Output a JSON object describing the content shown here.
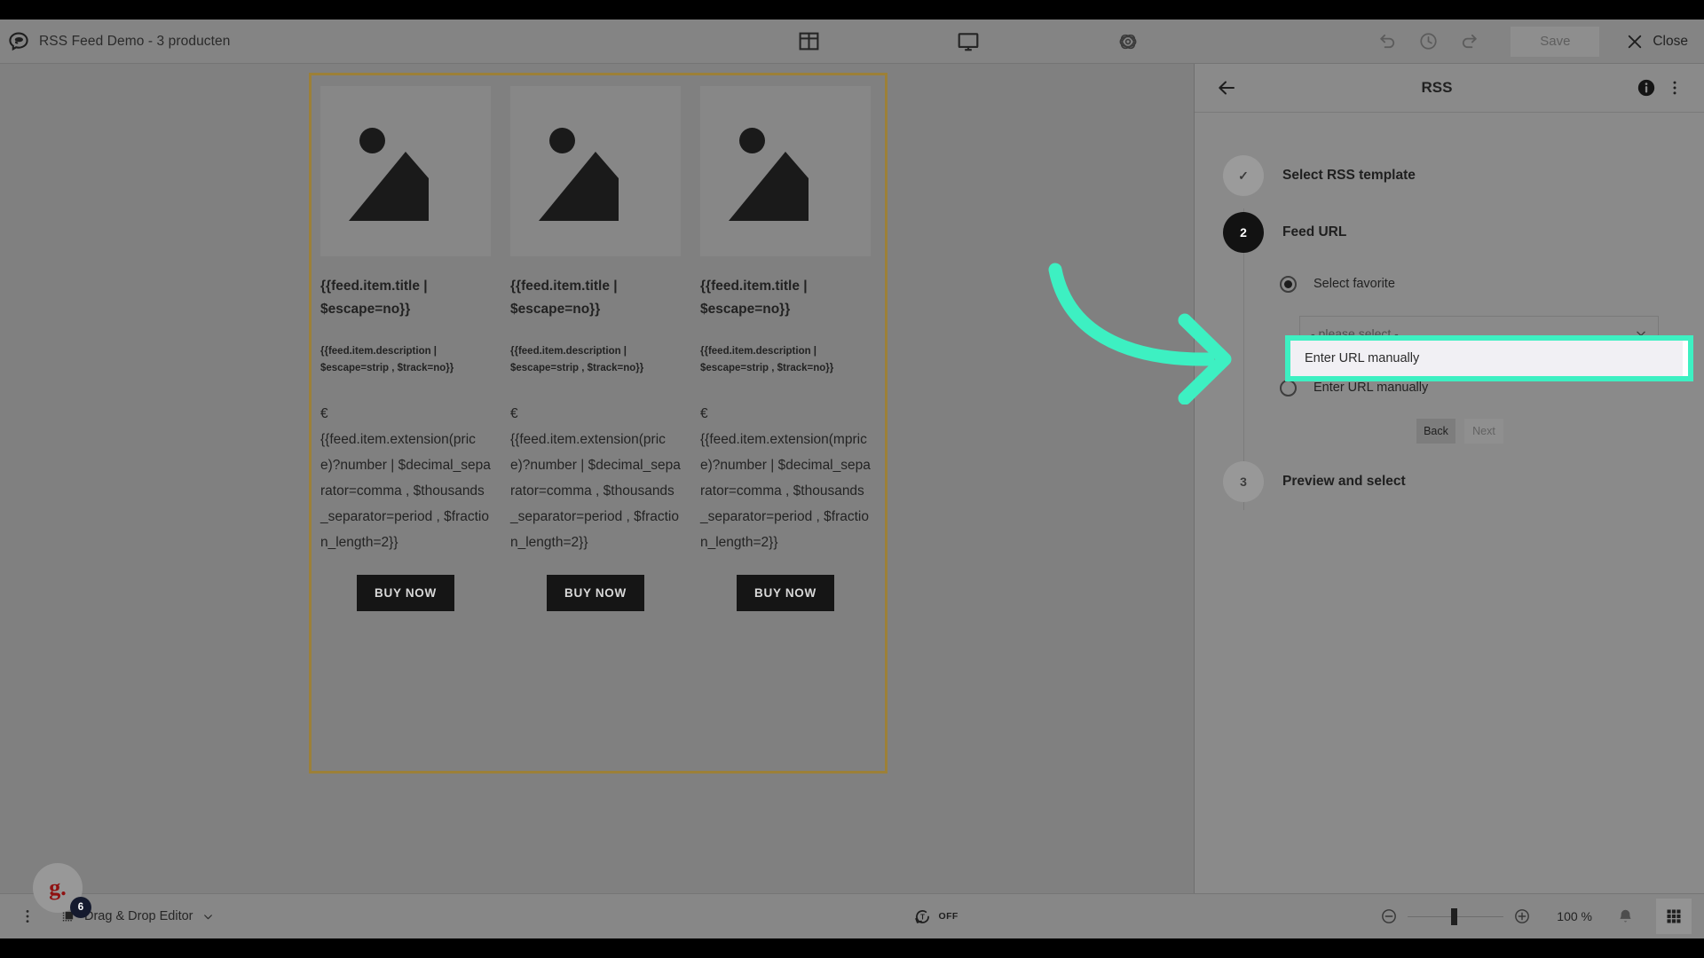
{
  "topbar": {
    "app_icon": "mail-logo-icon",
    "title": "RSS Feed Demo - 3 producten",
    "center_icons": [
      {
        "name": "layout-grid-icon",
        "label": "Layout"
      },
      {
        "name": "desktop-preview-icon",
        "label": "Preview"
      },
      {
        "name": "settings-atom-icon",
        "label": "Settings"
      }
    ],
    "undo_label": "Undo",
    "history_label": "History",
    "redo_label": "Redo",
    "save_label": "Save",
    "close_label": "Close"
  },
  "canvas": {
    "frame_border_color": "#9c8038",
    "cards": [
      {
        "image_placeholder": "image-placeholder-icon",
        "title": "{{feed.item.title | $escape=no}}",
        "description": "{{feed.item.description | $escape=strip , $track=no}}",
        "currency": "€",
        "price_expression": "{{feed.item.extension(price)?number | $decimal_separator=comma , $thousands_separator=period , $fraction_length=2}}",
        "button_label": "BUY NOW"
      },
      {
        "image_placeholder": "image-placeholder-icon",
        "title": "{{feed.item.title | $escape=no}}",
        "description": "{{feed.item.description | $escape=strip , $track=no}}",
        "currency": "€",
        "price_expression": "{{feed.item.extension(price)?number | $decimal_separator=comma , $thousands_separator=period , $fraction_length=2}}",
        "button_label": "BUY NOW"
      },
      {
        "image_placeholder": "image-placeholder-icon",
        "title": "{{feed.item.title | $escape=no}}",
        "description": "{{feed.item.description | $escape=strip , $track=no}}",
        "currency": "€",
        "price_expression": "{{feed.item.extension(mprice)?number | $decimal_separator=comma , $thousands_separator=period , $fraction_length=2}}",
        "button_label": "BUY NOW"
      }
    ]
  },
  "rss_panel": {
    "back_icon": "arrow-left-icon",
    "title": "RSS",
    "info_icon": "info-icon",
    "more_icon": "kebab-menu-icon",
    "steps": [
      {
        "number": "1",
        "state": "done",
        "marker": "✓",
        "label": "Select RSS template"
      },
      {
        "number": "2",
        "state": "active",
        "marker": "2",
        "label": "Feed URL"
      },
      {
        "number": "3",
        "state": "todo",
        "marker": "3",
        "label": "Preview and select"
      }
    ],
    "feed_url_step": {
      "option_favorite_label": "Select favorite",
      "option_favorite_selected": true,
      "select_value": "- please select -",
      "option_manual_label": "Enter URL manually",
      "option_manual_selected": false,
      "back_label": "Back",
      "next_label": "Next"
    }
  },
  "highlight": {
    "color": "#3df0c2",
    "target_label": "Enter URL manually",
    "arrow_icon": "curved-arrow-right-icon"
  },
  "bottombar": {
    "kebab_icon": "kebab-menu-icon",
    "editor_icon": "drag-drop-icon",
    "editor_label": "Drag & Drop Editor",
    "editor_chevron": "chevron-down-icon",
    "tracking_icon": "text-refresh-icon",
    "tracking_state": "OFF",
    "zoom_out_icon": "zoom-out-icon",
    "zoom_in_icon": "zoom-in-icon",
    "zoom_level": "100 %",
    "bell_icon": "bell-icon",
    "apps_icon": "apps-grid-icon"
  },
  "avatar": {
    "glyph": "g.",
    "badge_count": "6"
  }
}
